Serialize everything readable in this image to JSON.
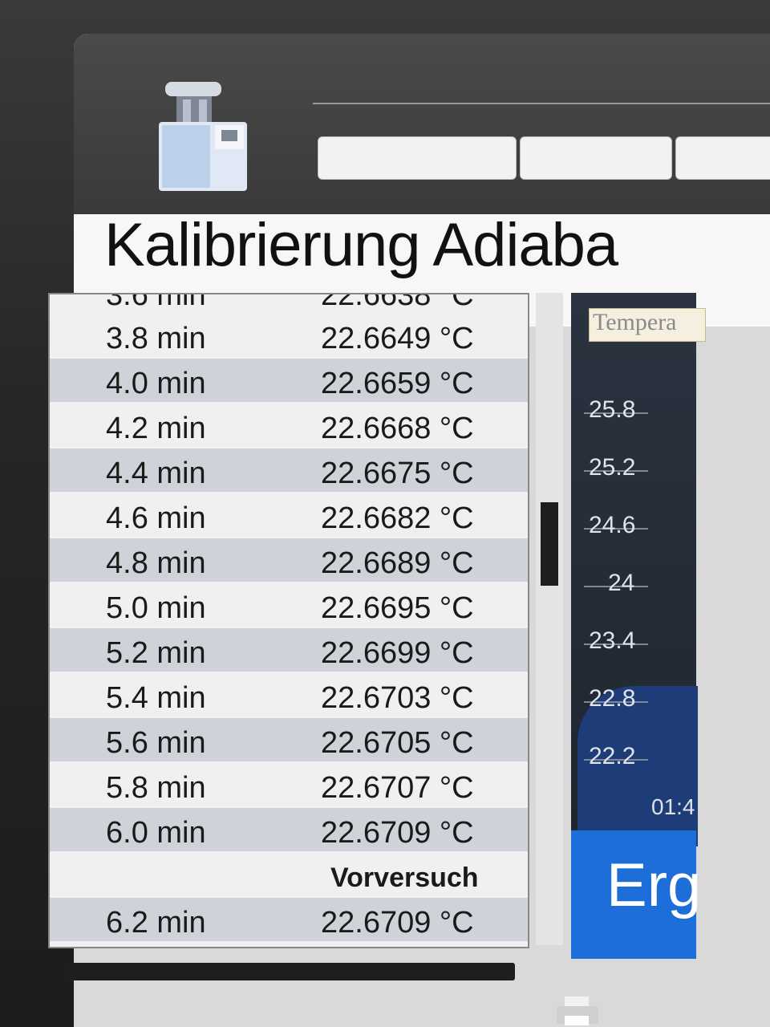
{
  "page": {
    "title": "Kalibrierung Adiaba"
  },
  "header": {
    "tabs": [
      "",
      "",
      ""
    ]
  },
  "table": {
    "rows": [
      {
        "time": "3.8 min",
        "value": "22.6649 °C"
      },
      {
        "time": "4.0 min",
        "value": "22.6659 °C"
      },
      {
        "time": "4.2 min",
        "value": "22.6668 °C"
      },
      {
        "time": "4.4 min",
        "value": "22.6675 °C"
      },
      {
        "time": "4.6 min",
        "value": "22.6682 °C"
      },
      {
        "time": "4.8 min",
        "value": "22.6689 °C"
      },
      {
        "time": "5.0 min",
        "value": "22.6695 °C"
      },
      {
        "time": "5.2 min",
        "value": "22.6699 °C"
      },
      {
        "time": "5.4 min",
        "value": "22.6703 °C"
      },
      {
        "time": "5.6 min",
        "value": "22.6705 °C"
      },
      {
        "time": "5.8 min",
        "value": "22.6707 °C"
      },
      {
        "time": "6.0 min",
        "value": "22.6709 °C"
      }
    ],
    "section_label": "Vorversuch",
    "after_section": [
      {
        "time": "6.2 min",
        "value": "22.6709 °C"
      }
    ]
  },
  "chart": {
    "title": "Tempera",
    "y_ticks": [
      "25.8",
      "25.2",
      "24.6",
      "24",
      "23.4",
      "22.8",
      "22.2"
    ],
    "time_label": "01:4"
  },
  "result_button": {
    "label": "Erg"
  },
  "icons": {
    "device": "calorimeter-device-icon",
    "printer": "printer-icon"
  },
  "colors": {
    "accent": "#1d6ed8",
    "row_shade": "#cfd2d8",
    "chart_bg": "#2b3340"
  }
}
